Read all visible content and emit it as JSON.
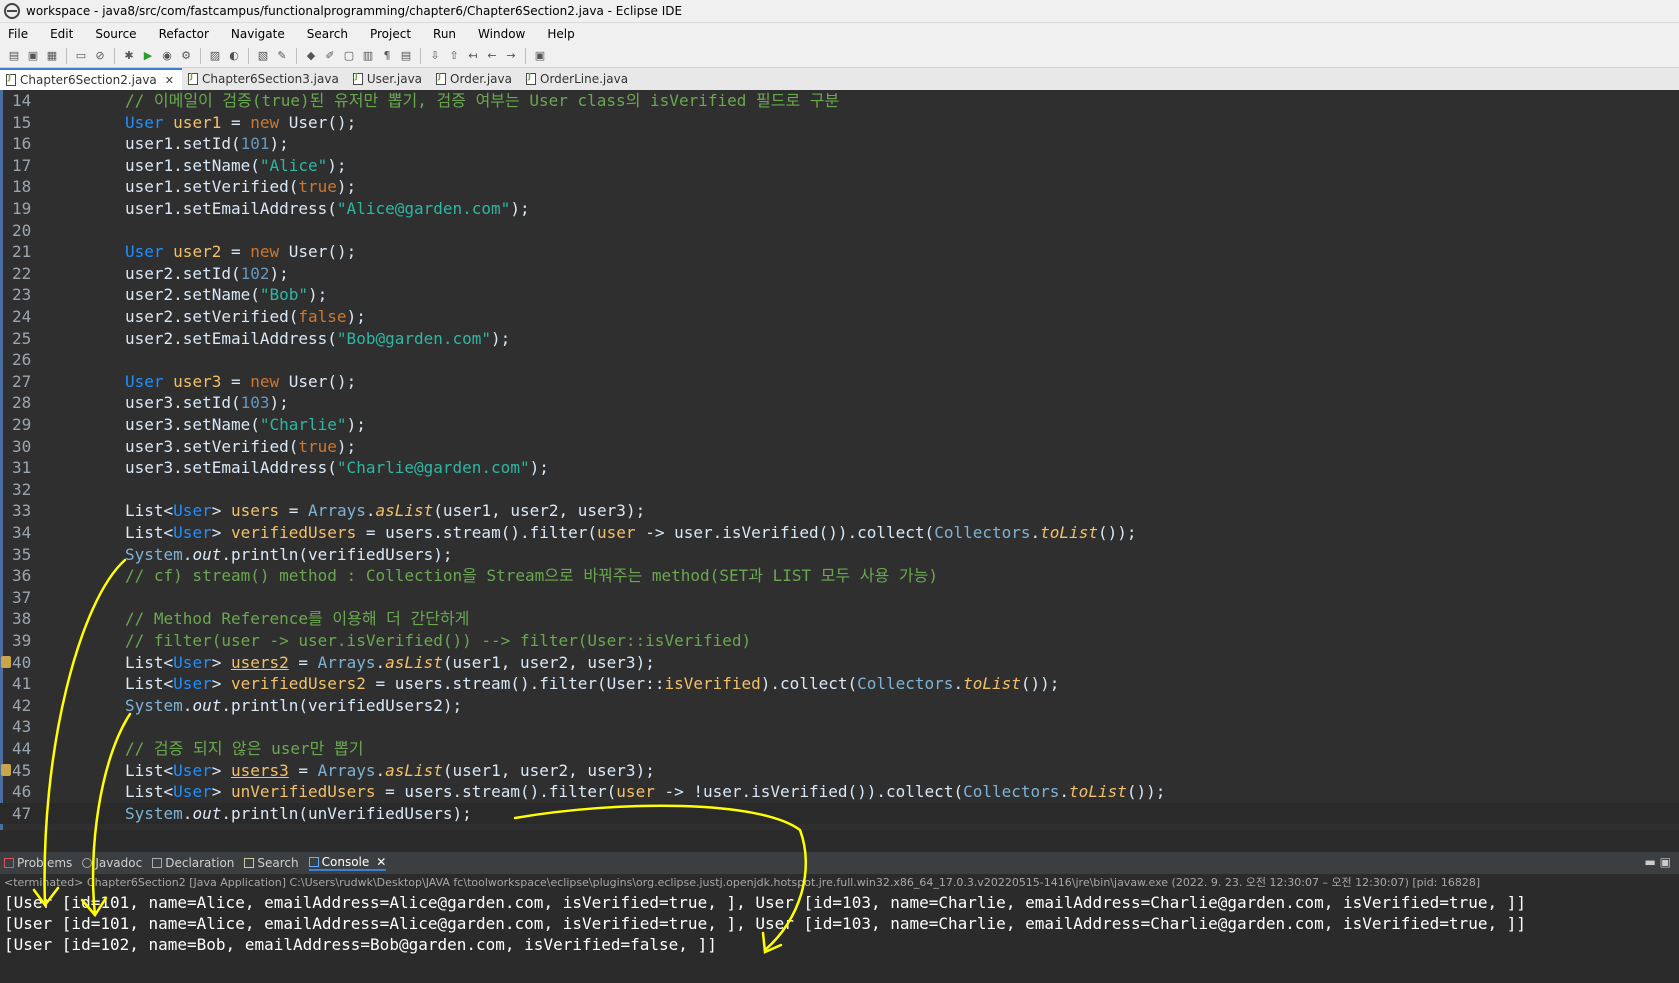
{
  "window": {
    "title": "workspace - java8/src/com/fastcampus/functionalprogramming/chapter6/Chapter6Section2.java - Eclipse IDE"
  },
  "menu": [
    "File",
    "Edit",
    "Source",
    "Refactor",
    "Navigate",
    "Search",
    "Project",
    "Run",
    "Window",
    "Help"
  ],
  "editor_tabs": [
    {
      "label": "Chapter6Section2.java",
      "active": true,
      "close": "✕"
    },
    {
      "label": "Chapter6Section3.java"
    },
    {
      "label": "User.java"
    },
    {
      "label": "Order.java"
    },
    {
      "label": "OrderLine.java"
    }
  ],
  "code": {
    "line_numbers": [
      "14",
      "15",
      "16",
      "17",
      "18",
      "19",
      "20",
      "21",
      "22",
      "23",
      "24",
      "25",
      "26",
      "27",
      "28",
      "29",
      "30",
      "31",
      "32",
      "33",
      "34",
      "35",
      "36",
      "37",
      "38",
      "39",
      "40",
      "41",
      "42",
      "43",
      "44",
      "45",
      "46",
      "47"
    ]
  },
  "panel_tabs": [
    "Problems",
    "Javadoc",
    "Declaration",
    "Search",
    "Console"
  ],
  "console": {
    "info": "<terminated> Chapter6Section2 [Java Application] C:\\Users\\rudwk\\Desktop\\JAVA fc\\toolworkspace\\eclipse\\plugins\\org.eclipse.justj.openjdk.hotspot.jre.full.win32.x86_64_17.0.3.v20220515-1416\\jre\\bin\\javaw.exe  (2022. 9. 23. 오전 12:30:07 – 오전 12:30:07) [pid: 16828]",
    "lines": [
      "[User [id=101, name=Alice, emailAddress=Alice@garden.com, isVerified=true, ], User [id=103, name=Charlie, emailAddress=Charlie@garden.com, isVerified=true, ]]",
      "[User [id=101, name=Alice, emailAddress=Alice@garden.com, isVerified=true, ], User [id=103, name=Charlie, emailAddress=Charlie@garden.com, isVerified=true, ]]",
      "[User [id=102, name=Bob, emailAddress=Bob@garden.com, isVerified=false, ]]"
    ]
  },
  "annotation_color": "#ffff00"
}
